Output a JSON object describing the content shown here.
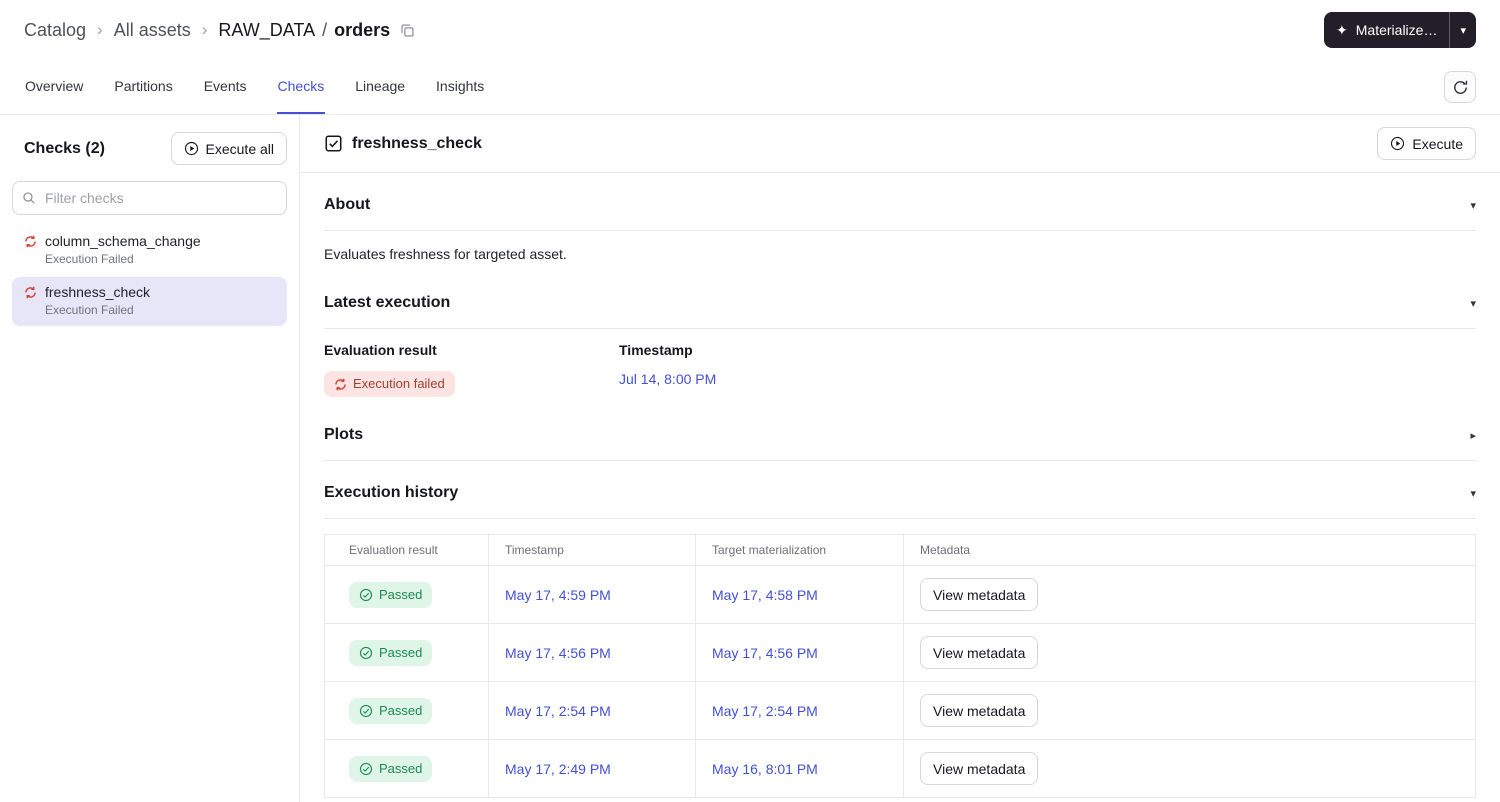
{
  "colors": {
    "accent": "#4350D4",
    "link": "#4350D4",
    "failed_badge_bg": "#FCE4E2",
    "failed_badge_text": "#A33E35",
    "failed_icon": "#D2453C",
    "passed_badge_bg": "#DFF5E7",
    "passed_badge_text": "#1D8A50",
    "selected_item_bg": "#E7E5F8",
    "dark_button_bg": "#221F2B"
  },
  "icons": {
    "sparkle": "✦",
    "caret_down": "▾",
    "section_expanded": "▾",
    "section_collapsed": "▸",
    "breadcrumb_separator": "›"
  },
  "breadcrumb": {
    "catalog": "Catalog",
    "all_assets": "All assets",
    "asset_group": "RAW_DATA",
    "path_separator": "/",
    "asset_name": "orders"
  },
  "header": {
    "materialize_label": "Materialize…"
  },
  "tabs": [
    {
      "label": "Overview",
      "active": false
    },
    {
      "label": "Partitions",
      "active": false
    },
    {
      "label": "Events",
      "active": false
    },
    {
      "label": "Checks",
      "active": true
    },
    {
      "label": "Lineage",
      "active": false
    },
    {
      "label": "Insights",
      "active": false
    }
  ],
  "sidebar": {
    "title": "Checks (2)",
    "execute_all_label": "Execute all",
    "filter_placeholder": "Filter checks",
    "items": [
      {
        "name": "column_schema_change",
        "status": "Execution Failed",
        "selected": false
      },
      {
        "name": "freshness_check",
        "status": "Execution Failed",
        "selected": true
      }
    ]
  },
  "main": {
    "title": "freshness_check",
    "execute_label": "Execute",
    "about": {
      "heading": "About",
      "body": "Evaluates freshness for targeted asset."
    },
    "latest_execution": {
      "heading": "Latest execution",
      "evaluation_label": "Evaluation result",
      "evaluation_value": "Execution failed",
      "timestamp_label": "Timestamp",
      "timestamp_value": "Jul 14, 8:00 PM"
    },
    "plots": {
      "heading": "Plots"
    },
    "history": {
      "heading": "Execution history",
      "columns": [
        "Evaluation result",
        "Timestamp",
        "Target materialization",
        "Metadata"
      ],
      "rows": [
        {
          "result": "Passed",
          "timestamp": "May 17, 4:59 PM",
          "target": "May 17, 4:58 PM",
          "metadata_label": "View metadata"
        },
        {
          "result": "Passed",
          "timestamp": "May 17, 4:56 PM",
          "target": "May 17, 4:56 PM",
          "metadata_label": "View metadata"
        },
        {
          "result": "Passed",
          "timestamp": "May 17, 2:54 PM",
          "target": "May 17, 2:54 PM",
          "metadata_label": "View metadata"
        },
        {
          "result": "Passed",
          "timestamp": "May 17, 2:49 PM",
          "target": "May 16, 8:01 PM",
          "metadata_label": "View metadata"
        }
      ]
    }
  }
}
